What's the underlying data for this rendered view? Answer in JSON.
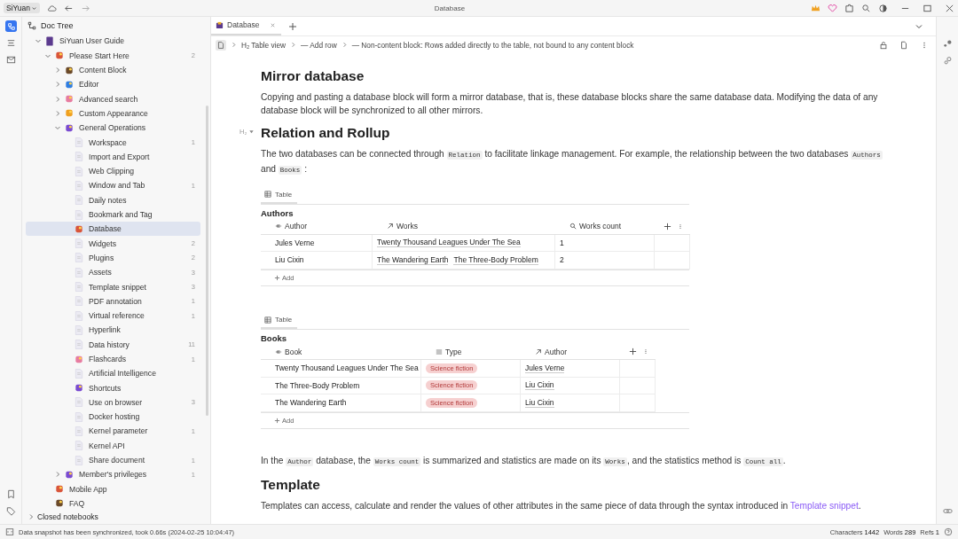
{
  "titlebar": {
    "workspace": "SiYuan",
    "title": "Database"
  },
  "sidebar": {
    "title": "Doc Tree",
    "tree": [
      {
        "label": "SiYuan User Guide",
        "kind": "notebook",
        "expanded": true,
        "selected": false,
        "children": [
          {
            "label": "Please Start Here",
            "kind": "emoji",
            "count": "2",
            "expanded": true,
            "selected": false,
            "children": [
              {
                "label": "Content Block",
                "kind": "emoji",
                "expanded": false,
                "selected": false
              },
              {
                "label": "Editor",
                "kind": "emoji",
                "expanded": false,
                "selected": false
              },
              {
                "label": "Advanced search",
                "kind": "emoji",
                "expanded": false,
                "selected": false
              },
              {
                "label": "Custom Appearance",
                "kind": "emoji",
                "expanded": false,
                "selected": false
              },
              {
                "label": "General Operations",
                "kind": "emoji",
                "expanded": true,
                "selected": false,
                "children": [
                  {
                    "label": "Workspace",
                    "kind": "doc",
                    "count": "1",
                    "selected": false
                  },
                  {
                    "label": "Import and Export",
                    "kind": "doc",
                    "selected": false
                  },
                  {
                    "label": "Web Clipping",
                    "kind": "doc",
                    "selected": false
                  },
                  {
                    "label": "Window and Tab",
                    "kind": "doc",
                    "count": "1",
                    "selected": false
                  },
                  {
                    "label": "Daily notes",
                    "kind": "doc",
                    "selected": false
                  },
                  {
                    "label": "Bookmark and Tag",
                    "kind": "doc",
                    "selected": false
                  },
                  {
                    "label": "Database",
                    "kind": "emoji",
                    "selected": true
                  },
                  {
                    "label": "Widgets",
                    "kind": "doc",
                    "count": "2",
                    "selected": false
                  },
                  {
                    "label": "Plugins",
                    "kind": "doc",
                    "count": "2",
                    "selected": false
                  },
                  {
                    "label": "Assets",
                    "kind": "doc",
                    "count": "3",
                    "selected": false
                  },
                  {
                    "label": "Template snippet",
                    "kind": "doc",
                    "count": "3",
                    "selected": false
                  },
                  {
                    "label": "PDF annotation",
                    "kind": "doc",
                    "count": "1",
                    "selected": false
                  },
                  {
                    "label": "Virtual reference",
                    "kind": "doc",
                    "count": "1",
                    "selected": false
                  },
                  {
                    "label": "Hyperlink",
                    "kind": "doc",
                    "selected": false
                  },
                  {
                    "label": "Data history",
                    "kind": "doc",
                    "count": "11",
                    "selected": false
                  },
                  {
                    "label": "Flashcards",
                    "kind": "emoji",
                    "count": "1",
                    "selected": false
                  },
                  {
                    "label": "Artificial Intelligence",
                    "kind": "doc",
                    "selected": false
                  },
                  {
                    "label": "Shortcuts",
                    "kind": "emoji",
                    "selected": false
                  },
                  {
                    "label": "Use on browser",
                    "kind": "doc",
                    "count": "3",
                    "selected": false
                  },
                  {
                    "label": "Docker hosting",
                    "kind": "doc",
                    "selected": false
                  },
                  {
                    "label": "Kernel parameter",
                    "kind": "doc",
                    "count": "1",
                    "selected": false
                  },
                  {
                    "label": "Kernel API",
                    "kind": "doc",
                    "selected": false
                  },
                  {
                    "label": "Share document",
                    "kind": "doc",
                    "count": "1",
                    "selected": false
                  }
                ]
              },
              {
                "label": "Member's privileges",
                "kind": "emoji",
                "count": "1",
                "expanded": false,
                "selected": false
              }
            ]
          },
          {
            "label": "Mobile App",
            "kind": "emoji",
            "selected": false
          },
          {
            "label": "FAQ",
            "kind": "emoji",
            "selected": false
          }
        ]
      }
    ],
    "closed": "Closed notebooks"
  },
  "tabs": [
    {
      "label": "Database",
      "selected": true
    }
  ],
  "breadcrumb": [
    {
      "prefix": "H₂",
      "label": "Table view"
    },
    {
      "prefix": "—",
      "label": "Add row"
    },
    {
      "prefix": "—",
      "label": "Non-content block: Rows added directly to the table, not bound to any content block"
    }
  ],
  "content": [
    {
      "kind": "h2",
      "text": "Mirror database"
    },
    {
      "kind": "p",
      "segments": [
        {
          "kind": "text",
          "text": "Copying and pasting a database block will form a mirror database, that is, these database blocks share the same database data. Modifying the data of any database block will be synchronized to all other mirrors."
        }
      ]
    },
    {
      "kind": "h2",
      "text": "Relation and Rollup",
      "gutter": "H₂"
    },
    {
      "kind": "p",
      "segments": [
        {
          "kind": "text",
          "text": "The two databases can be connected through "
        },
        {
          "kind": "code",
          "text": "Relation"
        },
        {
          "kind": "text",
          "text": " to facilitate linkage management. For example, the relationship between the two databases "
        },
        {
          "kind": "code",
          "text": "Authors"
        },
        {
          "kind": "text",
          "text": " and "
        },
        {
          "kind": "code",
          "text": "Books"
        },
        {
          "kind": "text",
          "text": " :"
        }
      ]
    },
    {
      "kind": "table",
      "view": "Table",
      "title": "Authors",
      "columns": [
        {
          "name": "Author",
          "kind": "primary"
        },
        {
          "name": "Works",
          "kind": "relation"
        },
        {
          "name": "Works count",
          "kind": "rollup"
        }
      ],
      "rows": [
        [
          [
            "Jules Verne"
          ],
          [
            "Twenty Thousand Leagues Under The Sea"
          ],
          [
            "1"
          ]
        ],
        [
          [
            "Liu Cixin"
          ],
          [
            "The Wandering Earth",
            "The Three-Body Problem"
          ],
          [
            "2"
          ]
        ]
      ],
      "add": "Add"
    },
    {
      "kind": "table",
      "view": "Table",
      "title": "Books",
      "columns": [
        {
          "name": "Book",
          "kind": "primary"
        },
        {
          "name": "Type",
          "kind": "select"
        },
        {
          "name": "Author",
          "kind": "relation"
        }
      ],
      "rows": [
        [
          [
            "Twenty Thousand Leagues Under The Sea"
          ],
          [
            "Science fiction"
          ],
          [
            "Jules Verne"
          ]
        ],
        [
          [
            "The Three-Body Problem"
          ],
          [
            "Science fiction"
          ],
          [
            "Liu Cixin"
          ]
        ],
        [
          [
            "The Wandering Earth"
          ],
          [
            "Science fiction"
          ],
          [
            "Liu Cixin"
          ]
        ]
      ],
      "add": "Add"
    },
    {
      "kind": "p",
      "segments": [
        {
          "kind": "text",
          "text": "In the "
        },
        {
          "kind": "code",
          "text": "Author"
        },
        {
          "kind": "text",
          "text": " database, the "
        },
        {
          "kind": "code",
          "text": "Works count"
        },
        {
          "kind": "text",
          "text": " is summarized and statistics are made on its "
        },
        {
          "kind": "code",
          "text": "Works"
        },
        {
          "kind": "text",
          "text": ", and the statistics method is "
        },
        {
          "kind": "code",
          "text": "Count all"
        },
        {
          "kind": "text",
          "text": "."
        }
      ]
    },
    {
      "kind": "h2",
      "text": "Template"
    },
    {
      "kind": "p",
      "segments": [
        {
          "kind": "text",
          "text": "Templates can access, calculate and render the values of other attributes in the same piece of data through the syntax introduced in "
        },
        {
          "kind": "link",
          "text": "Template snippet"
        },
        {
          "kind": "text",
          "text": "."
        }
      ]
    }
  ],
  "status": {
    "message": "Data snapshot has been synchronized, took 0.66s (2024-02-25 10:04:47)",
    "stats": [
      {
        "label": "Characters",
        "value": "1442"
      },
      {
        "label": "Words",
        "value": "289"
      },
      {
        "label": "Refs",
        "value": "1"
      }
    ]
  }
}
